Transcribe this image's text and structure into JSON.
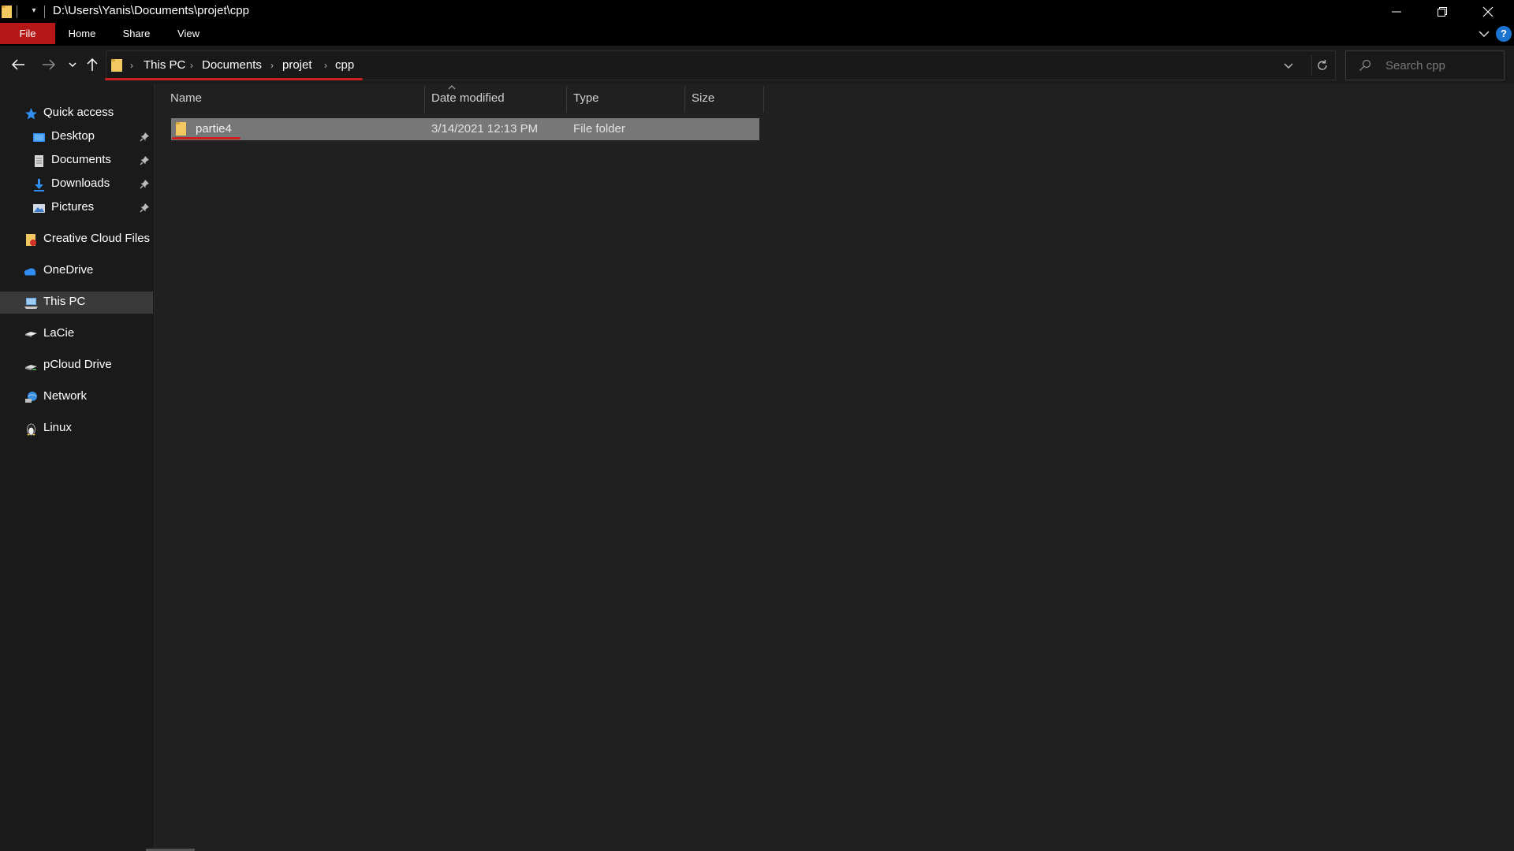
{
  "window": {
    "title": "D:\\Users\\Yanis\\Documents\\projet\\cpp"
  },
  "ribbon": {
    "tabs": [
      {
        "label": "File"
      },
      {
        "label": "Home"
      },
      {
        "label": "Share"
      },
      {
        "label": "View"
      }
    ],
    "help_label": "?"
  },
  "address": {
    "crumbs": [
      "This PC",
      "Documents",
      "projet",
      "cpp"
    ]
  },
  "search": {
    "placeholder": "Search cpp"
  },
  "sidebar": {
    "items": [
      {
        "label": "Quick access",
        "icon": "star-icon"
      },
      {
        "label": "Desktop",
        "icon": "desktop-icon",
        "pinned": true
      },
      {
        "label": "Documents",
        "icon": "documents-icon",
        "pinned": true
      },
      {
        "label": "Downloads",
        "icon": "downloads-icon",
        "pinned": true
      },
      {
        "label": "Pictures",
        "icon": "pictures-icon",
        "pinned": true
      },
      {
        "label": "Creative Cloud Files",
        "icon": "creative-cloud-icon"
      },
      {
        "label": "OneDrive",
        "icon": "cloud-icon"
      },
      {
        "label": "This PC",
        "icon": "computer-icon",
        "selected": true
      },
      {
        "label": "LaCie",
        "icon": "drive-icon"
      },
      {
        "label": "pCloud Drive",
        "icon": "network-drive-icon"
      },
      {
        "label": "Network",
        "icon": "network-icon"
      },
      {
        "label": "Linux",
        "icon": "linux-penguin-icon"
      }
    ]
  },
  "table": {
    "columns": [
      "Name",
      "Date modified",
      "Type",
      "Size"
    ],
    "rows": [
      {
        "name": "partie4",
        "date": "3/14/2021 12:13 PM",
        "type": "File folder",
        "size": "",
        "selected": true
      }
    ]
  },
  "colors": {
    "accent_red": "#cc1f1f",
    "file_tab": "#b51616",
    "folder_yellow": "#f4c860",
    "selection": "#777777"
  }
}
